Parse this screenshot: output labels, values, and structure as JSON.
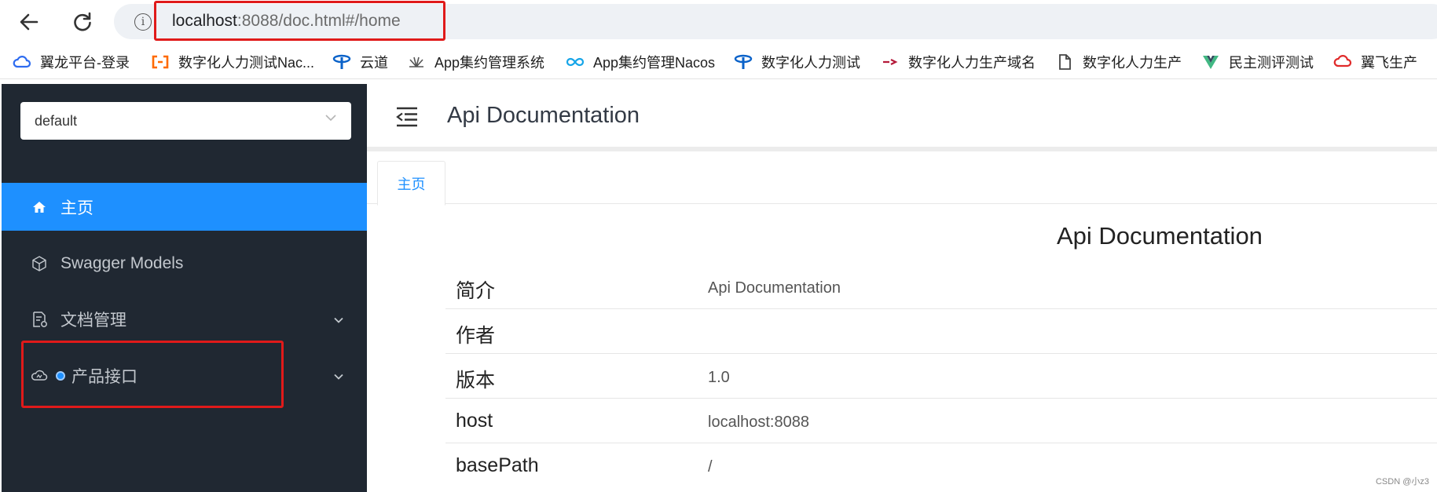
{
  "browser": {
    "url_host": "localhost",
    "url_rest": ":8088/doc.html#/home",
    "bookmarks": [
      {
        "label": "翼龙平台-登录",
        "icon": "cloud-icon"
      },
      {
        "label": "数字化人力测试Nac...",
        "icon": "aliyun-icon"
      },
      {
        "label": "云道",
        "icon": "telecom-icon"
      },
      {
        "label": "App集约管理系统",
        "icon": "huawei-icon"
      },
      {
        "label": "App集约管理Nacos",
        "icon": "infinity-icon"
      },
      {
        "label": "数字化人力测试",
        "icon": "telecom-icon"
      },
      {
        "label": "数字化人力生产域名",
        "icon": "brand-icon"
      },
      {
        "label": "数字化人力生产",
        "icon": "file-icon"
      },
      {
        "label": "民主测评测试",
        "icon": "vue-icon"
      },
      {
        "label": "翼飞生产",
        "icon": "cloud-red-icon"
      }
    ]
  },
  "sidebar": {
    "group_value": "default",
    "items": [
      {
        "label": "主页",
        "icon": "home-icon",
        "active": true
      },
      {
        "label": "Swagger Models",
        "icon": "cube-icon",
        "active": false
      },
      {
        "label": "文档管理",
        "icon": "doc-settings-icon",
        "active": false
      },
      {
        "label": "产品接口",
        "icon": "cloud-api-icon",
        "active": false
      }
    ]
  },
  "main": {
    "header_title": "Api Documentation",
    "tab_label": "主页",
    "doc_title": "Api Documentation",
    "info_rows": [
      {
        "key": "简介",
        "value": "Api Documentation"
      },
      {
        "key": "作者",
        "value": ""
      },
      {
        "key": "版本",
        "value": "1.0"
      },
      {
        "key": "host",
        "value": "localhost:8088"
      },
      {
        "key": "basePath",
        "value": "/"
      }
    ]
  },
  "watermark": "CSDN @小z3",
  "colors": {
    "sidebar_bg": "#202832",
    "accent": "#1e90ff",
    "highlight": "#e01a1a"
  }
}
